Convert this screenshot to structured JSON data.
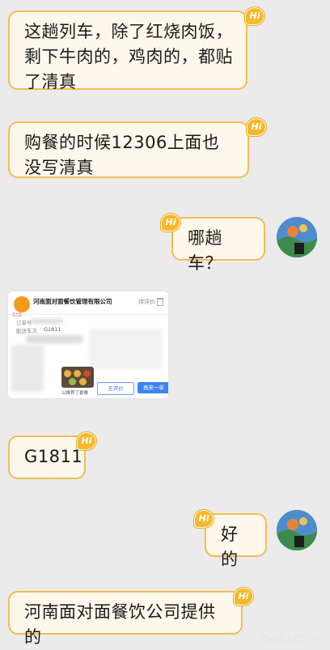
{
  "messages": [
    {
      "side": "left",
      "text": "这趟列车，除了红烧肉饭，剩下牛肉的，鸡肉的，都贴了清真"
    },
    {
      "side": "left",
      "text": "购餐的时候12306上面也没写清真"
    },
    {
      "side": "right",
      "text": "哪趟车？"
    },
    {
      "side": "left",
      "text": "G1811"
    },
    {
      "side": "right",
      "text": "好的"
    },
    {
      "side": "left",
      "text": "河南面对面餐饮公司提供的"
    }
  ],
  "badge": "Hi",
  "order_card": {
    "shop": "河南面对面餐饮管理有限公司",
    "status": "待评价",
    "order_label": "订单号",
    "delivery_label": "配送车次",
    "train": "G1811",
    "item_desc": "以推荐丁套餐",
    "btn_review": "去评价",
    "btn_reorder": "再来一单",
    "logo_text": "面对面"
  },
  "watermark": "@会员吧@9809",
  "colors": {
    "background": "#ebebeb",
    "bubble_fill": "#fdf8eb",
    "bubble_border": "#f0bd55",
    "badge": "#f7b829",
    "button_blue": "#3c85f0"
  }
}
